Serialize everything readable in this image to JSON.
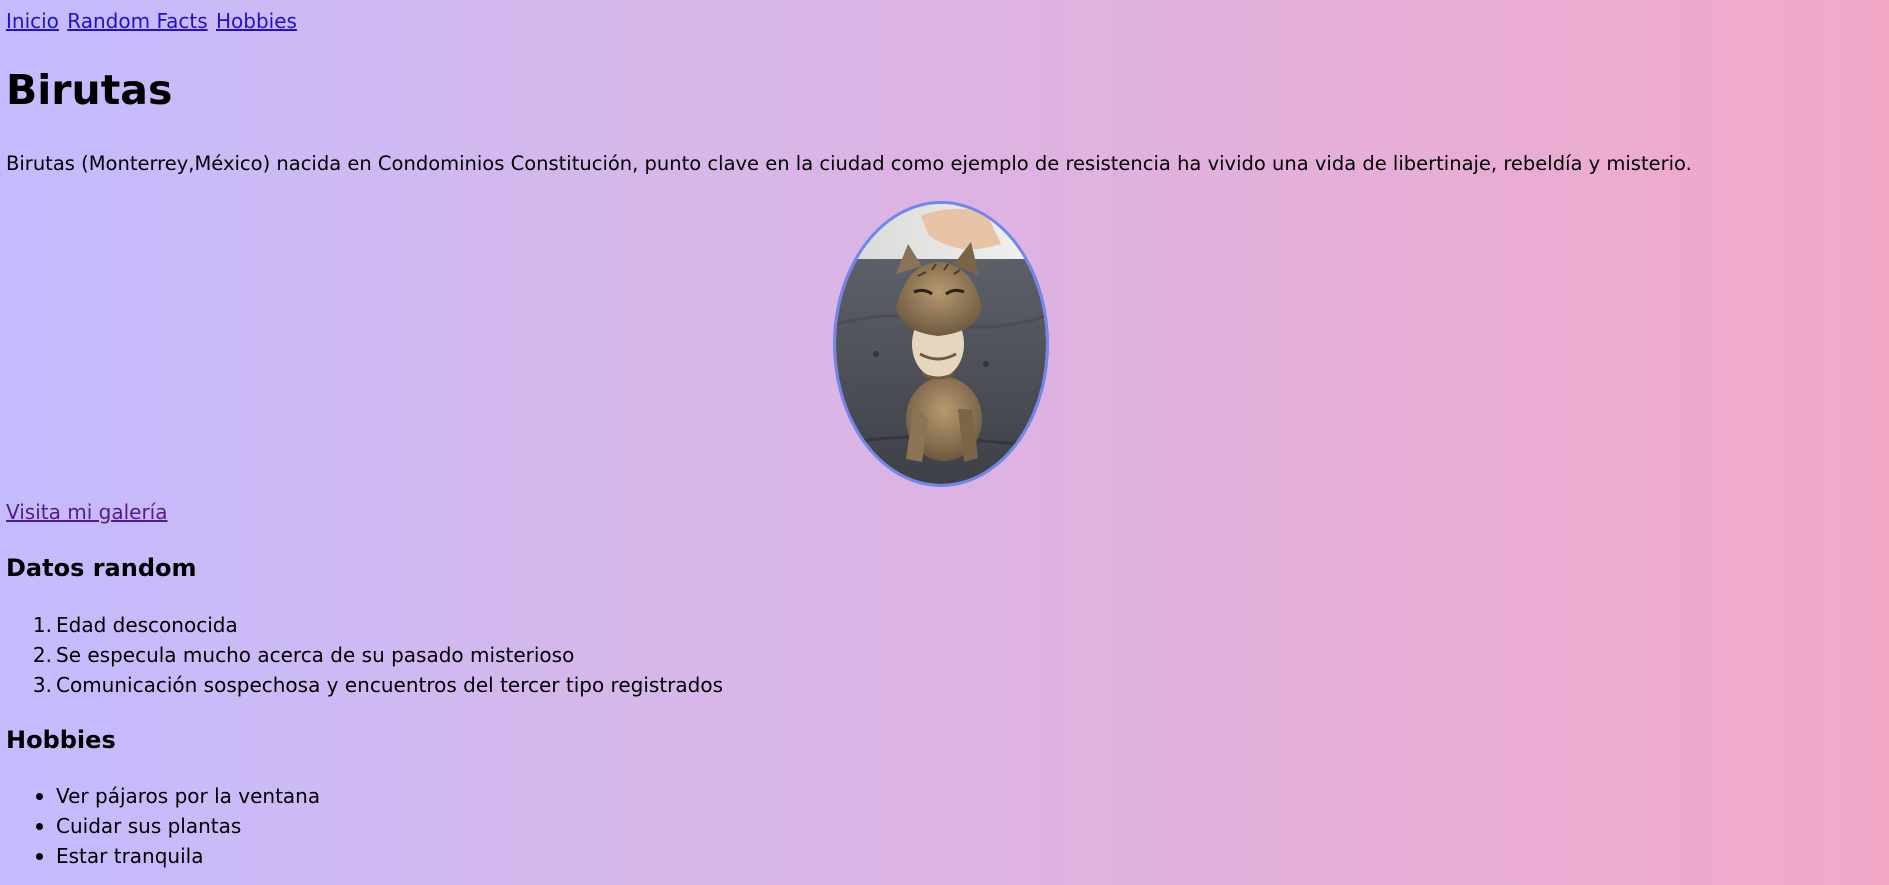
{
  "nav": {
    "links": [
      "Inicio",
      "Random Facts",
      "Hobbies"
    ]
  },
  "header": {
    "title": "Birutas"
  },
  "intro": {
    "text": "Birutas (Monterrey,México) nacida en Condominios Constitución, punto clave en la ciudad como ejemplo de resistencia ha vivido una vida de libertinaje, rebeldía y misterio."
  },
  "photo": {
    "subject": "tabby-cat-being-petted"
  },
  "gallery": {
    "link_label": "Visita mi galería"
  },
  "random_facts": {
    "heading": "Datos random",
    "numbers": [
      "1.",
      "2.",
      "3."
    ],
    "items": [
      "Edad desconocida",
      "Se especula mucho acerca de su pasado misterioso",
      "Comunicación sospechosa y encuentros del tercer tipo registrados"
    ]
  },
  "hobbies": {
    "heading": "Hobbies",
    "items": [
      "Ver pájaros por la ventana",
      "Cuidar sus plantas",
      "Estar tranquila"
    ]
  },
  "colors": {
    "background_start": "#c4bbff",
    "background_end": "#f3a8c8",
    "link": "#2211cc",
    "visited_link": "#551a8b",
    "photo_border": "#6f86ef"
  }
}
